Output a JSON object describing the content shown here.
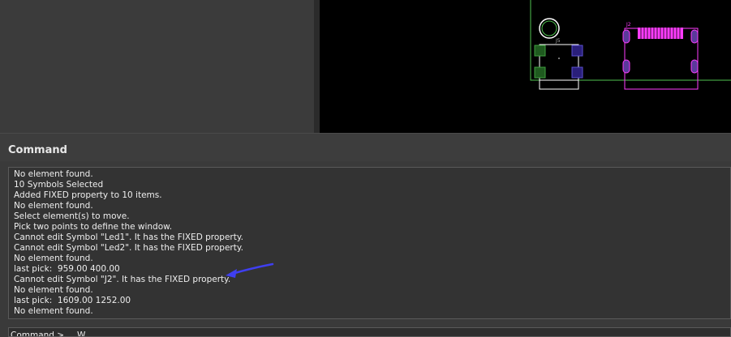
{
  "command_panel": {
    "title": "Command",
    "log": [
      "No element found.",
      "10 Symbols Selected",
      "Added FIXED property to 10 items.",
      "No element found.",
      "Select element(s) to move.",
      "Pick two points to define the window.",
      "Cannot edit Symbol \"Led1\". It has the FIXED property.",
      "Cannot edit Symbol \"Led2\". It has the FIXED property.",
      "No element found.",
      "last pick:  959.00 400.00",
      "Cannot edit Symbol \"J2\". It has the FIXED property.",
      "No element found.",
      "last pick:  1609.00 1252.00",
      "No element found."
    ],
    "prompt_label": "Command >",
    "input_value": "W"
  },
  "canvas": {
    "labels": {
      "j5": "J5",
      "j2": "J2"
    },
    "colors": {
      "board_outline": "#4fc24f",
      "silkscreen": "#ffffff",
      "connector": "#ff3cff",
      "pad_green": "#1f5a1f",
      "pad_blue": "#2a1f7a"
    }
  },
  "annotation": {
    "arrow_color": "#3f3ff0"
  }
}
